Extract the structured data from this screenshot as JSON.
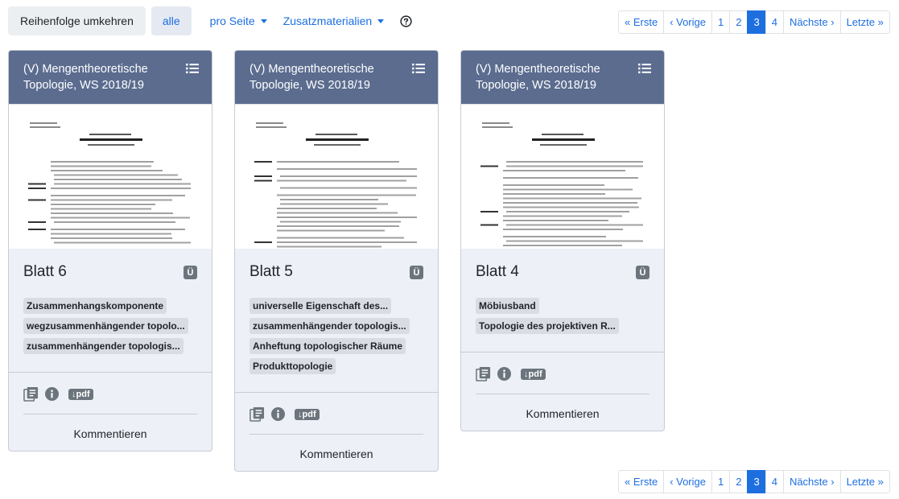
{
  "toolbar": {
    "reverse_label": "Reihenfolge umkehren",
    "all_label": "alle",
    "per_page_label": "pro Seite",
    "extras_label": "Zusatzmaterialien"
  },
  "pagination": [
    "« Erste",
    "‹ Vorige",
    "1",
    "2",
    "3",
    "4",
    "Nächste ›",
    "Letzte »"
  ],
  "pagination_active": "3",
  "cards": [
    {
      "header": "(V) Mengentheoretische Topologie, WS 2018/19",
      "title": "Blatt 6",
      "badge": "Ü",
      "tags": [
        "Zusammenhangskomponente",
        "wegzusammenhängender topolo...",
        "zusammenhängender topologis..."
      ],
      "pdf_label": "↓pdf",
      "comment_label": "Kommentieren"
    },
    {
      "header": "(V) Mengentheoretische Topologie, WS 2018/19",
      "title": "Blatt 5",
      "badge": "Ü",
      "tags": [
        "universelle Eigenschaft des...",
        "zusammenhängender topologis...",
        "Anheftung topologischer Räume",
        "Produkttopologie"
      ],
      "pdf_label": "↓pdf",
      "comment_label": "Kommentieren"
    },
    {
      "header": "(V) Mengentheoretische Topologie, WS 2018/19",
      "title": "Blatt 4",
      "badge": "Ü",
      "tags": [
        "Möbiusband",
        "Topologie des projektiven R..."
      ],
      "pdf_label": "↓pdf",
      "comment_label": "Kommentieren"
    }
  ]
}
